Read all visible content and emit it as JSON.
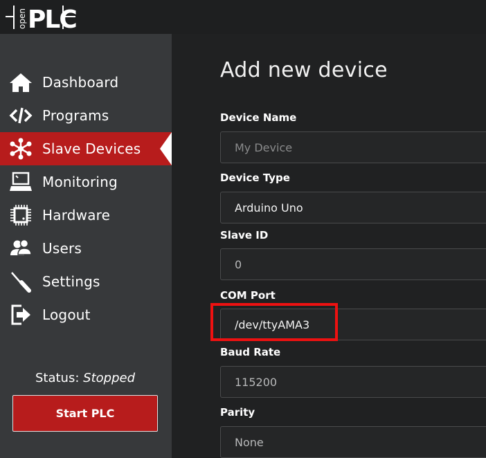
{
  "logo": {
    "small_text": "open",
    "big_text": "PLC"
  },
  "sidebar": {
    "items": [
      {
        "label": "Dashboard",
        "icon": "home-icon"
      },
      {
        "label": "Programs",
        "icon": "code-icon"
      },
      {
        "label": "Slave Devices",
        "icon": "network-icon",
        "active": true
      },
      {
        "label": "Monitoring",
        "icon": "monitor-icon"
      },
      {
        "label": "Hardware",
        "icon": "chip-icon"
      },
      {
        "label": "Users",
        "icon": "users-icon"
      },
      {
        "label": "Settings",
        "icon": "tools-icon"
      },
      {
        "label": "Logout",
        "icon": "logout-icon"
      }
    ],
    "status_label": "Status:",
    "status_value": "Stopped",
    "start_button": "Start PLC"
  },
  "main": {
    "title": "Add new device",
    "fields": {
      "device_name": {
        "label": "Device Name",
        "placeholder": "My Device"
      },
      "device_type": {
        "label": "Device Type",
        "value": "Arduino Uno"
      },
      "slave_id": {
        "label": "Slave ID",
        "value": "0"
      },
      "com_port": {
        "label": "COM Port",
        "value": "/dev/ttyAMA3"
      },
      "baud_rate": {
        "label": "Baud Rate",
        "value": "115200"
      },
      "parity": {
        "label": "Parity",
        "value": "None"
      }
    }
  },
  "colors": {
    "sidebar_bg": "#37393b",
    "active_bg": "#b71c1c",
    "main_bg": "#202122",
    "highlight": "#ee1111"
  }
}
